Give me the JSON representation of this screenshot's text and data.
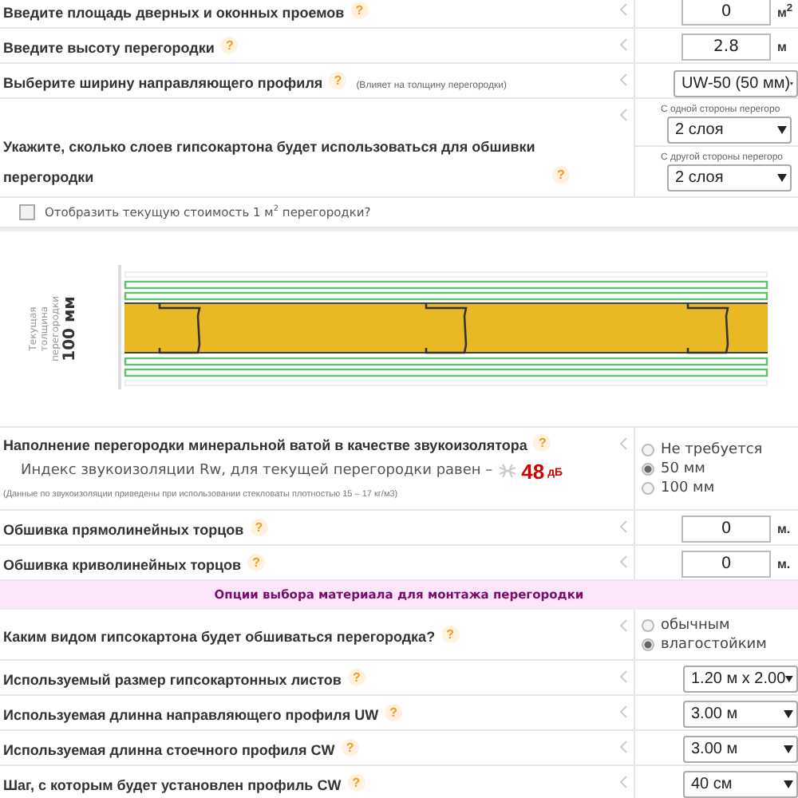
{
  "items": [
    {
      "kind": "input",
      "label": "Введите площадь дверных и оконных проемов",
      "help": "?",
      "value": "0",
      "unit": "м$^{2}$"
    },
    {
      "kind": "input",
      "label": "Введите высоту перегородки",
      "help": "?",
      "value": "2.8",
      "unit": "м"
    },
    {
      "kind": "select",
      "label": "Выберите ширину направляющего профиля",
      "help": "?",
      "note": "(Влияет на толщину перегородки)",
      "value": "UW-50 (50 мм)"
    },
    {
      "kind": "layers",
      "label": "Укажите, сколько слоев гипсокартона будет использоваться для обшивки перегородки",
      "help": "?",
      "sides": [
        {
          "caption": "С одной стороны перегоро",
          "value": "2 слоя"
        },
        {
          "caption": "С другой стороны перегоро",
          "value": "2 слоя"
        }
      ]
    },
    {
      "kind": "checkbox",
      "label": "Отобразить текущую стоимость 1 м$^{2}$ перегородки?",
      "checked": false
    },
    {
      "kind": "diagram",
      "caption": "Текущая толщина перегородки",
      "thickness": "100 мм"
    },
    {
      "kind": "sound",
      "label": "Наполнение перегородки минеральной ватой в качестве звукоизолятора",
      "help": "?",
      "index_label": "Индекс звукоизоляции Rw, для текущей перегородки равен –",
      "index_value": "48",
      "index_unit": "дБ",
      "footnote": "(Данные по звукоизоляции приведены при использовании стекловаты плотностью 15 – 17 кг/м3)",
      "options": [
        {
          "label": "Не требуется",
          "selected": false
        },
        {
          "label": "50 мм",
          "selected": true
        },
        {
          "label": "100 мм",
          "selected": false
        }
      ]
    },
    {
      "kind": "input",
      "label": "Обшивка прямолинейных торцов",
      "help": "?",
      "value": "0",
      "unit": "м."
    },
    {
      "kind": "input",
      "label": "Обшивка криволинейных торцов",
      "help": "?",
      "value": "0",
      "unit": "м."
    },
    {
      "kind": "section",
      "label": "Опции выбора материала для монтажа перегородки"
    },
    {
      "kind": "radio",
      "label": "Каким видом гипсокартона будет обшиваться перегородка?",
      "help": "?",
      "options": [
        {
          "label": "обычным",
          "selected": false
        },
        {
          "label": "влагостойким",
          "selected": true
        }
      ]
    },
    {
      "kind": "select",
      "label": "Используемый размер гипсокартонных листов",
      "help": "?",
      "value": "1.20 м x 2.00"
    },
    {
      "kind": "select",
      "label": "Используемая длинна направляющего профиля UW",
      "help": "?",
      "value": "3.00 м"
    },
    {
      "kind": "select",
      "label": "Используемая длинна стоечного профиля CW",
      "help": "?",
      "value": "3.00 м"
    },
    {
      "kind": "select",
      "label": "Шаг, с которым будет установлен профиль CW",
      "help": "?",
      "value": "40 см"
    }
  ]
}
